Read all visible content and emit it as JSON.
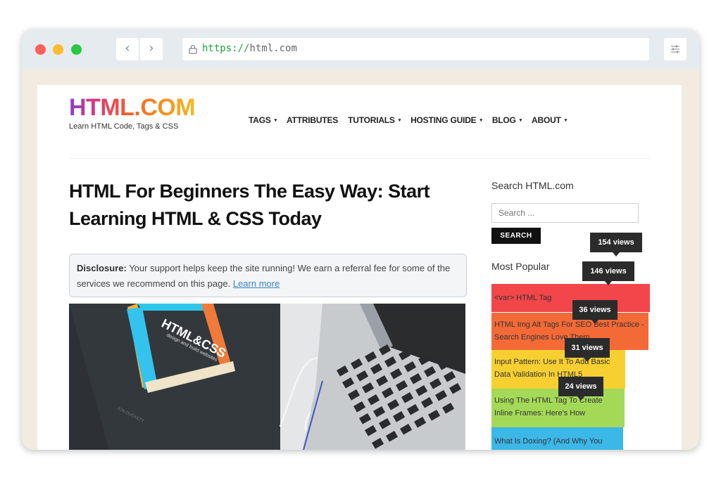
{
  "browser": {
    "url_scheme": "https",
    "url_separator": "://",
    "url_host": "html.com",
    "back_icon": "‹",
    "forward_icon": "›"
  },
  "site": {
    "logo": "HTML.COM",
    "tagline": "Learn HTML Code, Tags & CSS"
  },
  "nav": {
    "items": [
      {
        "label": "TAGS",
        "dropdown": true
      },
      {
        "label": "ATTRIBUTES",
        "dropdown": false
      },
      {
        "label": "TUTORIALS",
        "dropdown": true
      },
      {
        "label": "HOSTING GUIDE",
        "dropdown": true
      },
      {
        "label": "BLOG",
        "dropdown": true
      },
      {
        "label": "ABOUT",
        "dropdown": true
      }
    ]
  },
  "article": {
    "title": "HTML For Beginners The Easy Way: Start Learning HTML & CSS Today",
    "disclosure_label": "Disclosure:",
    "disclosure_text": "Your support helps keep the site running! We earn a referral fee for some of the services we recommend on this page.",
    "learn_more": "Learn more",
    "hero_book_title": "HTML&CSS",
    "hero_book_subtitle": "design and build websites",
    "hero_book_author": "JON DUCKETT"
  },
  "sidebar": {
    "search_heading": "Search HTML.com",
    "search_placeholder": "Search ...",
    "search_button": "SEARCH",
    "popular_heading": "Most Popular",
    "popular": [
      {
        "title": "<var> HTML Tag",
        "views": "154 views",
        "color": "#f2464a",
        "progress": 1.0
      },
      {
        "title": "HTML Img Alt Tags For SEO Best Practice - Search Engines Love Them",
        "views": "146 views",
        "color": "#f46a37",
        "progress": 0.95
      },
      {
        "title": "Input Pattern: Use It To Add Basic Data Validation In HTML5",
        "views": "36 views",
        "color": "#f7cf31",
        "progress": 0.23
      },
      {
        "title": "Using The HTML Tag To Create Inline Frames: Here's How",
        "views": "31 views",
        "color": "#a4d957",
        "progress": 0.2
      },
      {
        "title": "What Is Doxing? (And Why You Should Care)",
        "views": "24 views",
        "color": "#3bb7e8",
        "progress": 0.16
      }
    ]
  }
}
